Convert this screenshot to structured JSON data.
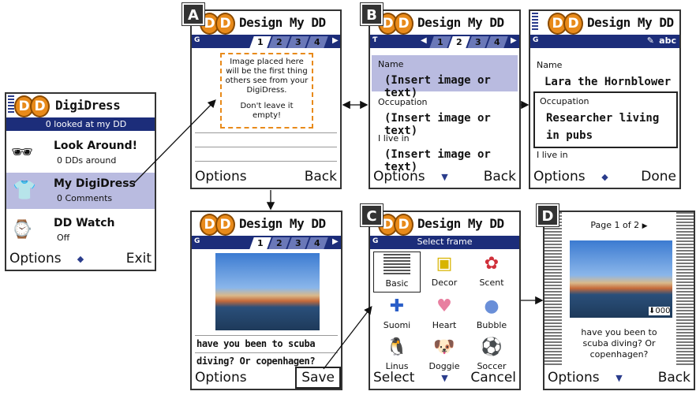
{
  "home": {
    "title": "DigiDress",
    "looked_at": "0 looked at my DD",
    "items": [
      {
        "title": "Look Around!",
        "sub": "0 DDs around"
      },
      {
        "title": "My DigiDress",
        "sub": "0 Comments"
      },
      {
        "title": "DD Watch",
        "sub": "Off"
      }
    ],
    "left_key": "Options",
    "right_key": "Exit"
  },
  "screen_a": {
    "marker": "A",
    "title": "Design My DD",
    "tabs": [
      "1",
      "2",
      "3",
      "4"
    ],
    "hint": "Image placed here will be the first thing others see from your DigiDress.",
    "hint2": "Don't leave it empty!",
    "left_key": "Options",
    "right_key": "Back"
  },
  "screen_b": {
    "marker": "B",
    "title": "Design My DD",
    "tabs": [
      "1",
      "2",
      "3",
      "4"
    ],
    "fields": [
      {
        "label": "Name",
        "value": "(Insert image or text)"
      },
      {
        "label": "Occupation",
        "value": "(Insert image or text)"
      },
      {
        "label": "I live in",
        "value": "(Insert image or text)"
      }
    ],
    "left_key": "Options",
    "right_key": "Back"
  },
  "screen_b2": {
    "title": "Design My DD",
    "mode": "abc",
    "name_label": "Name",
    "name_value": "Lara the Hornblower",
    "occ_label": "Occupation",
    "occ_value_1": "Researcher living",
    "occ_value_2": "in pubs",
    "live_label": "I live in",
    "left_key": "Options",
    "right_key": "Done"
  },
  "screen_a2": {
    "title": "Design My DD",
    "tabs": [
      "1",
      "2",
      "3",
      "4"
    ],
    "caption_1": "have you been to scuba",
    "caption_2": "diving? Or copenhagen?",
    "left_key": "Options",
    "right_key": "Save"
  },
  "screen_c": {
    "marker": "C",
    "title": "Design My DD",
    "subtitle": "Select frame",
    "frames": [
      {
        "name": "Basic",
        "icon": "basic-frame-icon"
      },
      {
        "name": "Decor",
        "icon": "decor-frame-icon"
      },
      {
        "name": "Scent",
        "icon": "scent-frame-icon"
      },
      {
        "name": "Suomi",
        "icon": "suomi-flag-icon"
      },
      {
        "name": "Heart",
        "icon": "heart-frame-icon"
      },
      {
        "name": "Bubble",
        "icon": "bubble-frame-icon"
      },
      {
        "name": "Linus",
        "icon": "penguin-icon"
      },
      {
        "name": "Doggie",
        "icon": "dog-icon"
      },
      {
        "name": "Soccer",
        "icon": "soccer-ball-icon"
      }
    ],
    "left_key": "Select",
    "right_key": "Cancel"
  },
  "screen_d": {
    "marker": "D",
    "page": "Page 1 of 2",
    "counter": "000",
    "caption": "have you been to scuba diving? Or copenhagen?",
    "left_key": "Options",
    "right_key": "Back"
  },
  "colors": {
    "accent": "#1c2d7a",
    "highlight": "#b9bbe0",
    "logo": "#e88a1a"
  }
}
